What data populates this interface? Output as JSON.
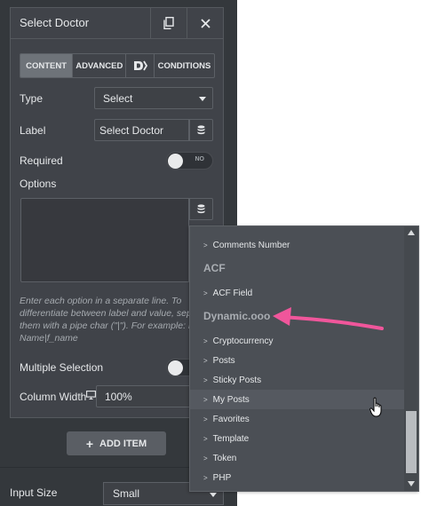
{
  "panel": {
    "title": "Select Doctor",
    "tabs": [
      {
        "label": "CONTENT",
        "active": true
      },
      {
        "label": "ADVANCED",
        "active": false
      },
      {
        "label": "",
        "icon": "dynamic-logo-icon",
        "active": false
      },
      {
        "label": "CONDITIONS",
        "active": false
      }
    ],
    "type_label": "Type",
    "type_value": "Select",
    "label_label": "Label",
    "label_value": "Select Doctor",
    "required_label": "Required",
    "required_toggle": "NO",
    "options_label": "Options",
    "options_help": "Enter each option in a separate line. To differentiate between label and value, separate them with a pipe char (\"|\"). For example: First Name|f_name",
    "multiple_label": "Multiple Selection",
    "column_width_label": "Column Width",
    "column_width_value": "100%",
    "add_item_label": "ADD ITEM",
    "input_size_label": "Input Size",
    "input_size_value": "Small"
  },
  "dropdown": {
    "items": [
      {
        "type": "item",
        "label": "Comments Number"
      },
      {
        "type": "group",
        "label": "ACF"
      },
      {
        "type": "item",
        "label": "ACF Field"
      },
      {
        "type": "group",
        "label": "Dynamic.ooo"
      },
      {
        "type": "item",
        "label": "Cryptocurrency"
      },
      {
        "type": "item",
        "label": "Posts"
      },
      {
        "type": "item",
        "label": "Sticky Posts"
      },
      {
        "type": "item",
        "label": "My Posts",
        "hovered": true
      },
      {
        "type": "item",
        "label": "Favorites"
      },
      {
        "type": "item",
        "label": "Template"
      },
      {
        "type": "item",
        "label": "Token"
      },
      {
        "type": "item",
        "label": "PHP"
      }
    ]
  },
  "colors": {
    "panel_bg": "#34383c",
    "card_bg": "#404349",
    "active_tab": "#6e7379",
    "dropdown_bg": "#4b4f55",
    "annotation_arrow": "#f0569b"
  }
}
